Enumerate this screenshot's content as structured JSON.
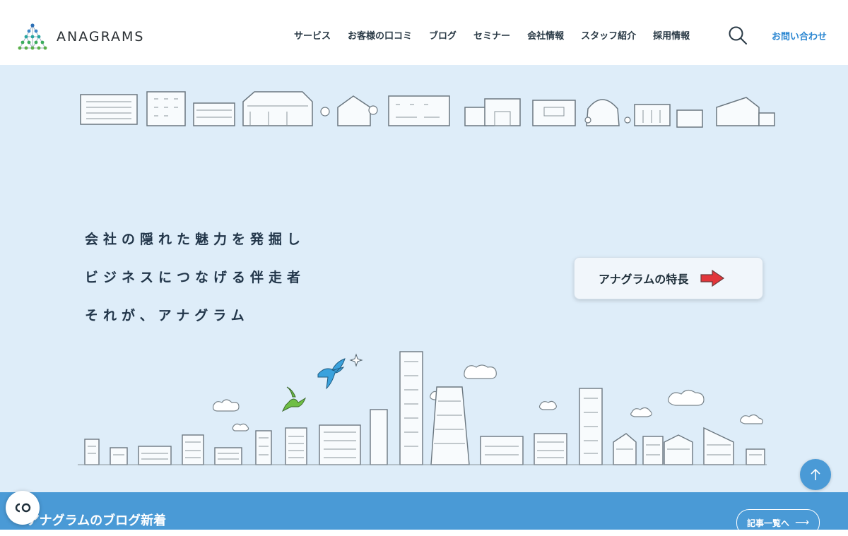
{
  "header": {
    "logo_text": "ANAGRAMS",
    "nav": [
      "サービス",
      "お客様の口コミ",
      "ブログ",
      "セミナー",
      "会社情報",
      "スタッフ紹介",
      "採用情報"
    ],
    "search_icon": "search-icon",
    "contact_label": "お問い合わせ"
  },
  "hero": {
    "tagline": [
      "会社の隠れた魅力を発掘し",
      "ビジネスにつなげる伴走者",
      "それが、アナグラム"
    ],
    "feature_button_label": "アナグラムの特長",
    "arrow_color": "#e2353a"
  },
  "blog": {
    "title": "アナグラムのブログ新着",
    "more_label": "記事一覧へ"
  },
  "colors": {
    "accent": "#4a9ad6",
    "hero_bg": "#deedf9",
    "link": "#2a86d1"
  },
  "widgets": {
    "to_top_icon": "arrow-up-icon",
    "cookie_icon": "cookie-consent-icon"
  }
}
